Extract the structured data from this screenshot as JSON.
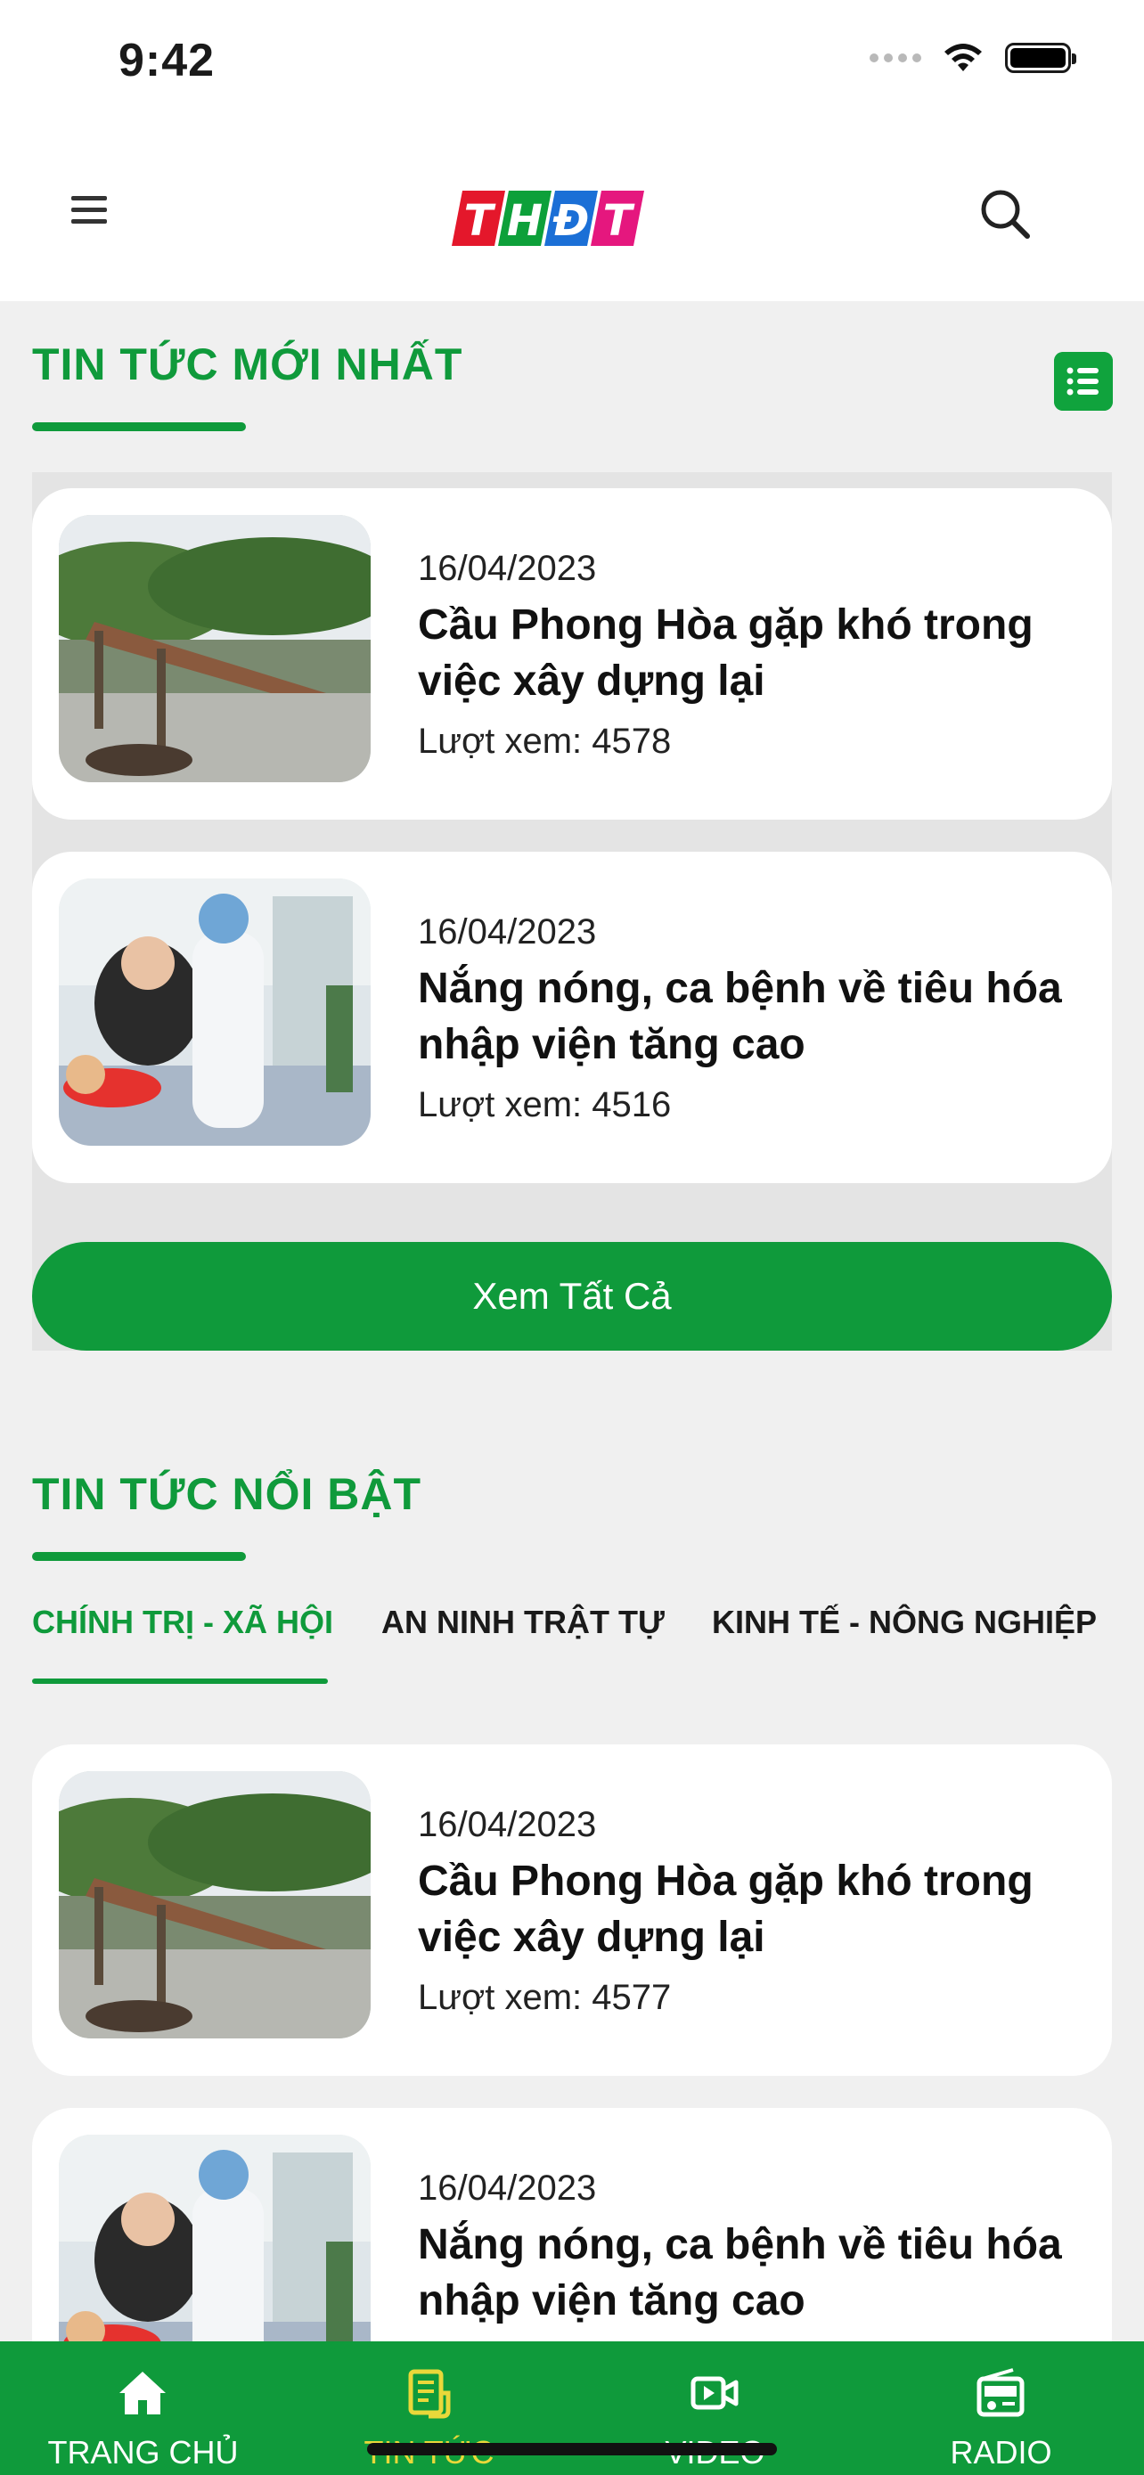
{
  "status_bar": {
    "time": "9:42"
  },
  "header": {
    "logo_text": "THĐT",
    "logo_colors": [
      "#e4172b",
      "#0da03a",
      "#1b6fd6",
      "#e5177e"
    ]
  },
  "latest_section": {
    "title": "TIN TỨC MỚI NHẤT",
    "see_all_label": "Xem Tất Cả",
    "articles": [
      {
        "date": "16/04/2023",
        "title": "Cầu Phong Hòa gặp khó trong việc xây dựng lại",
        "views": "Lượt xem: 4578",
        "thumb": "bridge-photo"
      },
      {
        "date": "16/04/2023",
        "title": "Nắng nóng, ca bệnh về tiêu hóa nhập viện tăng cao",
        "views": "Lượt xem: 4516",
        "thumb": "hospital-photo"
      }
    ]
  },
  "featured_section": {
    "title": "TIN TỨC NỔI BẬT",
    "tabs": [
      "CHÍNH TRỊ - XÃ HỘI",
      "AN NINH TRẬT TỰ",
      "KINH TẾ - NÔNG NGHIỆP"
    ],
    "active_tab": "CHÍNH TRỊ - XÃ HỘI",
    "articles": [
      {
        "date": "16/04/2023",
        "title": "Cầu Phong Hòa gặp khó trong việc xây dựng lại",
        "views": "Lượt xem: 4577",
        "thumb": "bridge-photo"
      },
      {
        "date": "16/04/2023",
        "title": "Nắng nóng, ca bệnh về tiêu hóa nhập viện tăng cao",
        "views": "",
        "thumb": "hospital-photo"
      }
    ]
  },
  "bottom_nav": [
    {
      "label": "TRANG CHỦ",
      "icon": "home-icon",
      "active": false
    },
    {
      "label": "TIN TỨC",
      "icon": "news-icon",
      "active": true
    },
    {
      "label": "VIDEO",
      "icon": "video-icon",
      "active": false
    },
    {
      "label": "RADIO",
      "icon": "radio-icon",
      "active": false
    }
  ],
  "colors": {
    "brand_green": "#0f9a3b",
    "active_nav": "#e9d83a"
  }
}
